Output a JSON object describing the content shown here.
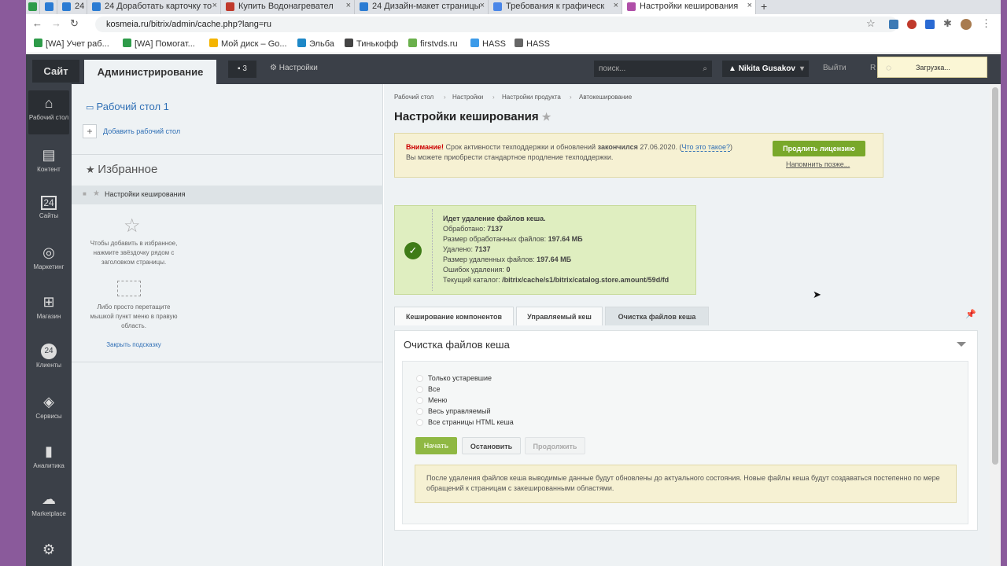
{
  "browser": {
    "tabs": [
      {
        "label": "24",
        "color": "#2a7bd3"
      },
      {
        "label": "24  Доработать карточку то",
        "color": "#2a7bd3"
      },
      {
        "label": "Купить Водонагревател",
        "color": "#c0392b"
      },
      {
        "label": "24  Дизайн-макет страницы",
        "color": "#2a7bd3"
      },
      {
        "label": "Требования к графическ",
        "color": "#4a86e8"
      },
      {
        "label": "Настройки кеширования",
        "color": "#b04fa8"
      }
    ],
    "close_glyph": "×",
    "new_tab": "+",
    "address": "kosmeia.ru/bitrix/admin/cache.php?lang=ru",
    "bookmarks": [
      {
        "label": "[WA] Учет раб...",
        "color": "#2e9b49"
      },
      {
        "label": "[WA] Помогат...",
        "color": "#2e9b49"
      },
      {
        "label": "Мой диск – Go...",
        "color": "#f4b400"
      },
      {
        "label": "Эльба",
        "color": "#1e88c7"
      },
      {
        "label": "Тинькофф",
        "color": "#444"
      },
      {
        "label": "firstvds.ru",
        "color": "#6ab04c"
      },
      {
        "label": "HASS",
        "color": "#3d9be9"
      },
      {
        "label": "HASS",
        "color": "#666"
      }
    ]
  },
  "topbar": {
    "site": "Сайт",
    "admin": "Администрирование",
    "notifications": "3",
    "settings": "Настройки",
    "search_placeholder": "поиск...",
    "user": "Nikita Gusakov",
    "logout": "Выйти",
    "lang": "R",
    "loading": "Загрузка..."
  },
  "leftnav": [
    {
      "label": "Рабочий стол",
      "icon": "⌂"
    },
    {
      "label": "Контент",
      "icon": "▤"
    },
    {
      "label": "Сайты",
      "icon": "24"
    },
    {
      "label": "Маркетинг",
      "icon": "◎"
    },
    {
      "label": "Магазин",
      "icon": "⊞"
    },
    {
      "label": "Клиенты",
      "icon": "24"
    },
    {
      "label": "Сервисы",
      "icon": "◈"
    },
    {
      "label": "Аналитика",
      "icon": "▮"
    },
    {
      "label": "Marketplace",
      "icon": "☁"
    },
    {
      "label": "",
      "icon": "⚙"
    }
  ],
  "desktop": {
    "title": "Рабочий стол 1",
    "add_desktop": "Добавить рабочий стол",
    "favorites_title": "Избранное",
    "favorite_item": "Настройки кеширования",
    "hint1": "Чтобы добавить в избранное, нажмите звёздочку рядом с заголовком страницы.",
    "hint2": "Либо просто перетащите мышкой пункт меню в правую область.",
    "close_hint": "Закрыть подсказку"
  },
  "main": {
    "breadcrumbs": [
      "Рабочий стол",
      "Настройки",
      "Настройки продукта",
      "Автокеширование"
    ],
    "title": "Настройки кеширования",
    "warning": {
      "attention": "Внимание!",
      "text1": "Срок активности техподдержки и обновлений",
      "ended": "закончился",
      "date": "27.06.2020.",
      "link": "Что это такое?",
      "text2": "Вы можете приобрести стандартное продление техподдержки.",
      "prolong": "Продлить лицензию",
      "remind": "Напомнить позже..."
    },
    "status": {
      "title": "Идет удаление файлов кеша.",
      "processed_label": "Обработано:",
      "processed": "7137",
      "size_processed_label": "Размер обработанных файлов:",
      "size_processed": "197.64 МБ",
      "deleted_label": "Удалено:",
      "deleted": "7137",
      "size_deleted_label": "Размер удаленных файлов:",
      "size_deleted": "197.64 МБ",
      "errors_label": "Ошибок удаления:",
      "errors": "0",
      "dir_label": "Текущий каталог:",
      "dir": "/bitrix/cache/s1/bitrix/catalog.store.amount/59d/fd"
    },
    "tabs": [
      "Кеширование компонентов",
      "Управляемый кеш",
      "Очистка файлов кеша"
    ],
    "panel_title": "Очистка файлов кеша",
    "options": [
      "Только устаревшие",
      "Все",
      "Меню",
      "Весь управляемый",
      "Все страницы HTML кеша"
    ],
    "btn_start": "Начать",
    "btn_stop": "Остановить",
    "btn_continue": "Продолжить",
    "info": "После удаления файлов кеша выводимые данные будут обновлены до актуального состояния. Новые файлы кеша будут создаваться постепенно по мере обращений к страницам с закешированными областями."
  }
}
